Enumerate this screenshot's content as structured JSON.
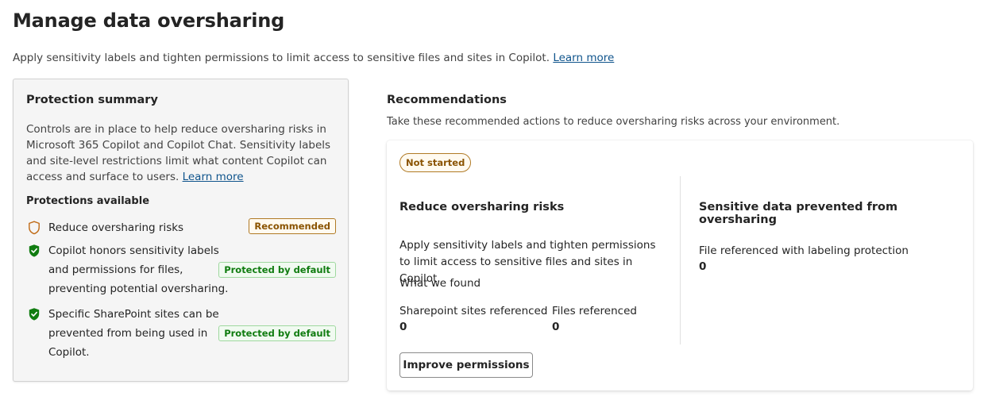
{
  "page": {
    "title": "Manage data oversharing",
    "description": "Apply sensitivity labels and tighten permissions to limit access to sensitive files and sites in Copilot.",
    "learn_more": "Learn more"
  },
  "summary": {
    "title": "Protection summary",
    "description": "Controls are in place to help reduce oversharing risks in Microsoft 365 Copilot and Copilot Chat. Sensitivity labels and site-level restrictions limit what content Copilot can access and surface to users.",
    "learn_more": "Learn more",
    "protections_heading": "Protections available",
    "items": [
      {
        "icon": "shield-outline-icon",
        "text": "Reduce oversharing risks",
        "badge": "Recommended"
      },
      {
        "icon": "shield-check-icon",
        "text": "Copilot honors sensitivity labels and permissions for files, preventing potential oversharing.",
        "badge": "Protected by default"
      },
      {
        "icon": "shield-check-icon",
        "text": "Specific SharePoint sites can be prevented from being used in Copilot.",
        "badge": "Protected by default"
      }
    ]
  },
  "recommendations": {
    "title": "Recommendations",
    "description": "Take these recommended actions to reduce oversharing risks across your environment.",
    "card": {
      "status": "Not started",
      "left": {
        "title": "Reduce oversharing risks",
        "description": "Apply sensitivity labels and tighten permissions to limit access to sensitive files and sites in Copilot.",
        "found_label": "What we found",
        "metrics": [
          {
            "label": "Sharepoint sites referenced",
            "value": "0"
          },
          {
            "label": "Files referenced",
            "value": "0"
          }
        ],
        "button": "Improve permissions"
      },
      "right": {
        "title": "Sensitive data prevented from oversharing",
        "metric_label": "File referenced with labeling protection",
        "metric_value": "0"
      }
    }
  },
  "colors": {
    "link": "#0f548c",
    "recommended": "#8a5300",
    "protected": "#107c10",
    "shield_outline": "#c06b16"
  }
}
